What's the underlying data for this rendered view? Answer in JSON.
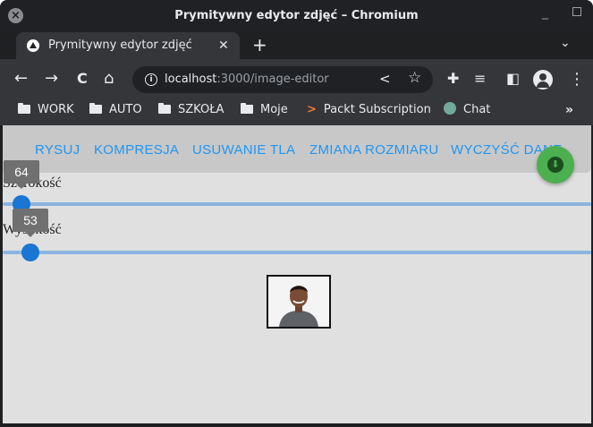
{
  "window": {
    "title": "Prymitywny edytor zdjęć – Chromium"
  },
  "tab": {
    "title": "Prymitywny edytor zdjęć",
    "close": "✕",
    "new_tab": "+"
  },
  "toolbar": {
    "back": "←",
    "forward": "→",
    "reload": "C",
    "home": "⌂",
    "url_host": "localhost",
    "url_path": ":3000/image-editor"
  },
  "bookmarks": [
    {
      "label": "WORK",
      "icon": "folder-icon"
    },
    {
      "label": "AUTO",
      "icon": "folder-icon"
    },
    {
      "label": "SZKOŁA",
      "icon": "folder-icon"
    },
    {
      "label": "Moje",
      "icon": "folder-icon"
    },
    {
      "label": "Packt Subscription",
      "icon": "packt-icon"
    },
    {
      "label": "Chat",
      "icon": "chat-icon"
    }
  ],
  "app_nav": [
    "RYSUJ",
    "KOMPRESJA",
    "USUWANIE TLA",
    "ZMIANA ROZMIARU",
    "WYCZYŚĆ DANE"
  ],
  "sliders": [
    {
      "label": "Szerokość",
      "value": "64"
    },
    {
      "label": "Wysokość",
      "value": "53"
    }
  ],
  "colors": {
    "accent": "#2196f3",
    "slider": "#1976d2",
    "fab": "#4caf50",
    "page_bg": "#e0e0e0"
  }
}
